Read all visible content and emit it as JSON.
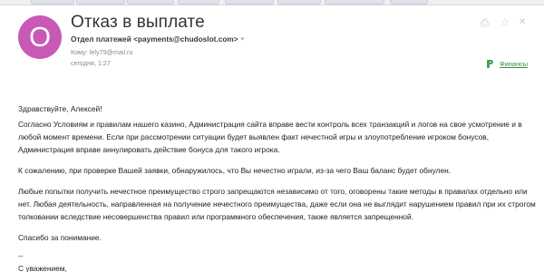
{
  "message": {
    "subject": "Отказ в выплате",
    "avatar_letter": "О",
    "sender": "Отдел платежей <payments@chudoslot.com>",
    "recipient": "Кому: lely79@mail.ru",
    "date": "сегодня, 1:27",
    "label": "Финансы"
  },
  "icons": {
    "sender_dropdown": "chevron-down-icon",
    "print": "print-icon",
    "star": "star-icon",
    "close": "close-icon",
    "label": "label-icon"
  },
  "colors": {
    "avatar": "#c85ab6",
    "label": "#3aa657"
  },
  "body": {
    "greeting": "Здравствуйте, Алексей!",
    "paragraph1": "Согласно Условиям и правилам нашего казино, Администрация сайта вправе вести контроль всех транзакций и логов на свое усмотрение и в любой момент времени. Если при рассмотрении ситуации будет выявлен факт нечестной игры и злоупотребление игроком бонусов, Администрация вправе аннулировать действие бонуса для такого игрока.",
    "paragraph2": "К сожалению, при проверке Вашей заявки, обнаружилось, что Вы нечестно играли, из-за чего Ваш баланс будет обнулен.",
    "paragraph3": "Любые попытки получить нечестное преимущество строго запрещаются независимо от того, оговорены такие методы в правилах отдельно или нет. Любая деятельность, направленная на получение нечестного преимущества, даже если она не выглядит нарушением правил при их строгом толковании вследствие несовершенства правил или программного обеспечения, также является запрещенной.",
    "thanks": "Спасибо за понимание.",
    "signature_dash": "--",
    "regards": "С уважением,"
  }
}
